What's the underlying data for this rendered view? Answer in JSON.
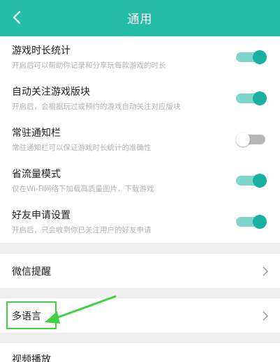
{
  "header": {
    "title": "通用",
    "back_icon": "chevron-left-icon",
    "color": "#24bba7"
  },
  "settings": [
    {
      "title": "游戏时长统计",
      "subtitle": "开启后可以帮助你记录和分享玩每款游戏的时长",
      "on": true
    },
    {
      "title": "自动关注游戏版块",
      "subtitle": "开启后，会根据玩过或预约的游戏自动关注对应版块",
      "on": true
    },
    {
      "title": "常驻通知栏",
      "subtitle": "常驻通知栏可以保证游戏时长统计的准确性",
      "on": false
    },
    {
      "title": "省流量模式",
      "subtitle": "仅在Wi-Fi网络下加载高质量图片，下载游戏",
      "on": true
    },
    {
      "title": "好友申请设置",
      "subtitle": "开启后，只会收到你已关注用户的好友申请",
      "on": true
    }
  ],
  "links": [
    {
      "label": "微信提醒",
      "icon": "chevron-right-icon"
    },
    {
      "label": "多语言",
      "icon": "chevron-right-icon",
      "highlighted": true
    },
    {
      "label": "视频播放"
    }
  ],
  "colors": {
    "toggle_on": "#1ab0a2",
    "toggle_track_on": "#7cd6cb",
    "toggle_off": "#b7b7b7",
    "highlight": "#43d047"
  }
}
